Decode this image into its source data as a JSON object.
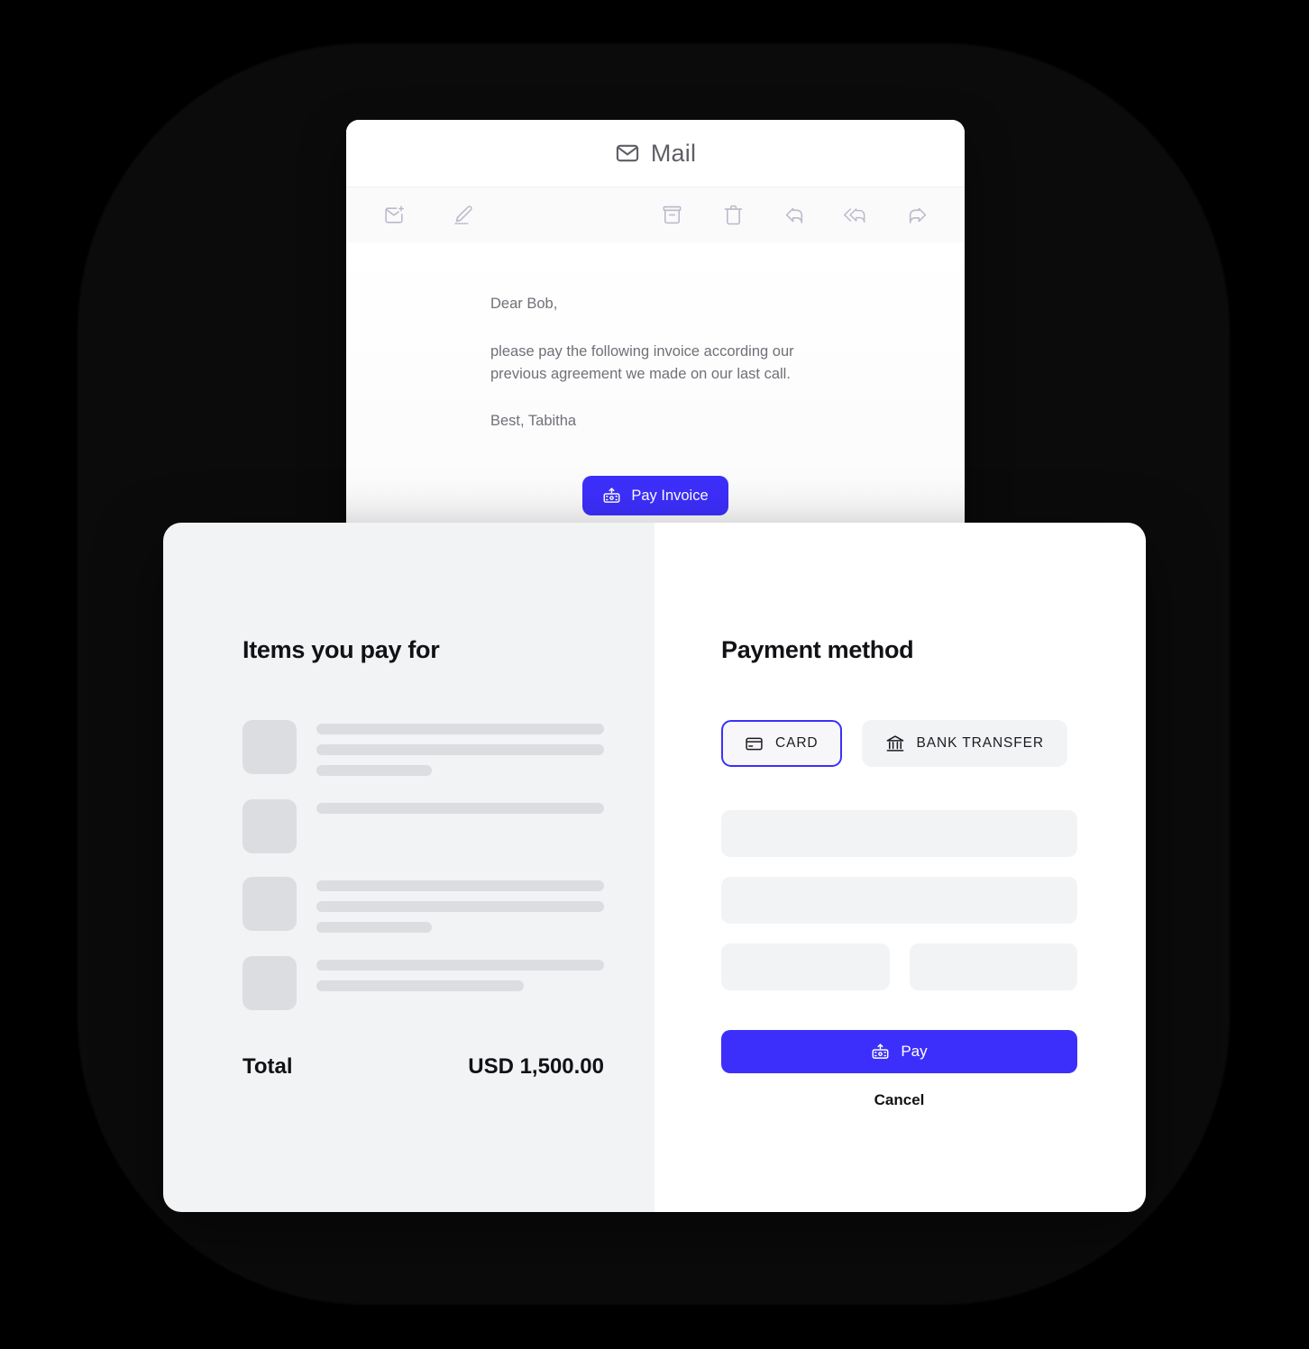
{
  "theme": {
    "accent": "#3D2FFB",
    "background": "#000000",
    "panel_left_bg": "#F2F3F5",
    "panel_right_bg": "#FFFFFF",
    "skeleton_gray": "#DCDDE0",
    "field_gray": "#F2F3F5",
    "body_text": "#6F7178",
    "heading_text": "#111216"
  },
  "mail": {
    "title": "Mail",
    "title_icon": "envelope-icon",
    "toolbar": {
      "left_actions": [
        {
          "name": "mark-unread-icon",
          "label": "Mark as unread"
        },
        {
          "name": "compose-pencil-icon",
          "label": "Compose"
        }
      ],
      "right_actions": [
        {
          "name": "archive-icon",
          "label": "Archive"
        },
        {
          "name": "trash-icon",
          "label": "Delete"
        },
        {
          "name": "reply-icon",
          "label": "Reply"
        },
        {
          "name": "reply-all-icon",
          "label": "Reply all"
        },
        {
          "name": "forward-icon",
          "label": "Forward"
        }
      ]
    },
    "body": {
      "greeting": "Dear Bob,",
      "paragraph": "please pay the following invoice according our previous agreement we made on our last call.",
      "signoff": "Best, Tabitha"
    },
    "pay_invoice_button": {
      "label": "Pay Invoice",
      "icon": "payment-terminal-icon"
    }
  },
  "checkout": {
    "items_panel": {
      "heading": "Items you pay for",
      "skeleton_items": [
        {
          "thumbnail": true,
          "lines": [
            100,
            100,
            40
          ]
        },
        {
          "thumbnail": true,
          "lines": [
            100
          ]
        },
        {
          "thumbnail": true,
          "lines": [
            100,
            100,
            40
          ]
        },
        {
          "thumbnail": true,
          "lines": [
            100,
            72
          ]
        }
      ],
      "total_label": "Total",
      "total_value": "USD 1,500.00"
    },
    "payment_panel": {
      "heading": "Payment method",
      "methods": [
        {
          "label": "CARD",
          "icon": "credit-card-icon",
          "selected": true
        },
        {
          "label": "BANK TRANSFER",
          "icon": "bank-icon",
          "selected": false
        }
      ],
      "form_fields": [
        {
          "name": "card-number-field",
          "width": "full"
        },
        {
          "name": "cardholder-name-field",
          "width": "full"
        },
        {
          "name": "expiry-field",
          "width": "half"
        },
        {
          "name": "cvc-field",
          "width": "half"
        }
      ],
      "pay_button": {
        "label": "Pay",
        "icon": "payment-terminal-icon"
      },
      "cancel_button": {
        "label": "Cancel"
      }
    }
  }
}
